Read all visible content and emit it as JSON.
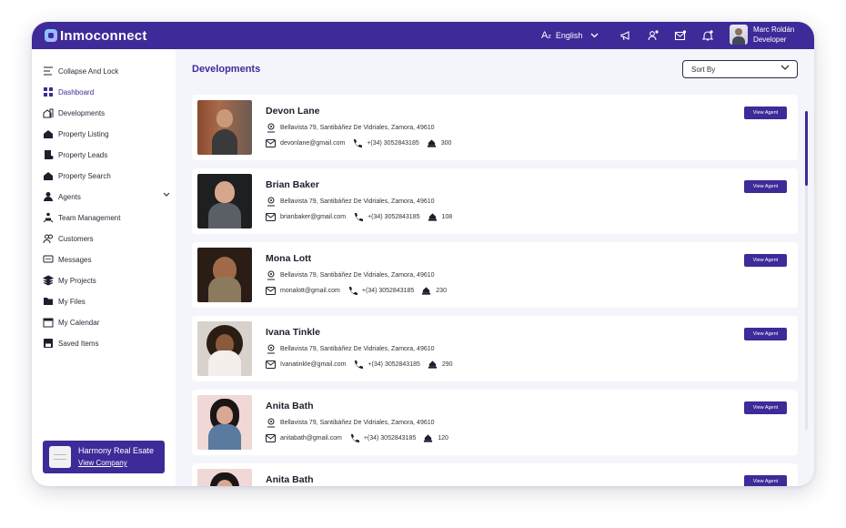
{
  "app": {
    "title": "Inmoconnect"
  },
  "topbar": {
    "language": "English",
    "user_name": "Marc Roldán",
    "user_role": "Developer"
  },
  "sidebar": {
    "items": [
      {
        "label": "Collapse And Lock",
        "icon": "collapse-icon"
      },
      {
        "label": "Dashboard",
        "icon": "dashboard-icon",
        "active": true
      },
      {
        "label": "Developments",
        "icon": "buildings-icon"
      },
      {
        "label": "Property Listing",
        "icon": "house-icon"
      },
      {
        "label": "Property Leads",
        "icon": "leads-icon"
      },
      {
        "label": "Property Search",
        "icon": "house-search-icon"
      },
      {
        "label": "Agents",
        "icon": "agent-icon",
        "expandable": true
      },
      {
        "label": "Team Management",
        "icon": "team-icon"
      },
      {
        "label": "Customers",
        "icon": "customers-icon"
      },
      {
        "label": "Messages",
        "icon": "messages-icon"
      },
      {
        "label": "My Projects",
        "icon": "layers-icon"
      },
      {
        "label": "My Files",
        "icon": "folder-icon"
      },
      {
        "label": "My Calendar",
        "icon": "calendar-icon"
      },
      {
        "label": "Saved Items",
        "icon": "save-icon"
      }
    ],
    "company": {
      "name": "Harmony Real Esate",
      "link": "View Company"
    }
  },
  "main": {
    "title": "Developments",
    "sort_label": "Sort By",
    "view_button_label": "View Agent",
    "agents": [
      {
        "name": "Devon Lane",
        "address": "Bellavista 79, Santibáñez De Vidriales, Zamora, 49610",
        "email": "devonlane@gmail.com",
        "phone": "+(34) 3052843185",
        "count": "300"
      },
      {
        "name": "Brian Baker",
        "address": "Bellavista 79, Santibáñez De Vidriales, Zamora, 49610",
        "email": "brianbaker@gmail.com",
        "phone": "+(34) 3052843185",
        "count": "108"
      },
      {
        "name": "Mona Lott",
        "address": "Bellavista 79, Santibáñez De Vidriales, Zamora, 49610",
        "email": "monalott@gmail.com",
        "phone": "+(34) 3052843185",
        "count": "230"
      },
      {
        "name": "Ivana Tinkle",
        "address": "Bellavista 79, Santibáñez De Vidriales, Zamora, 49610",
        "email": "Ivanatinkle@gmail.com",
        "phone": "+(34) 3052843185",
        "count": "290"
      },
      {
        "name": "Anita Bath",
        "address": "Bellavista 79, Santibáñez De Vidriales, Zamora, 49610",
        "email": "anitabath@gmail.com",
        "phone": "+(34) 3052843185",
        "count": "120"
      },
      {
        "name": "Anita Bath"
      }
    ]
  },
  "colors": {
    "brand": "#3e2a98",
    "background": "#f4f5fb"
  }
}
